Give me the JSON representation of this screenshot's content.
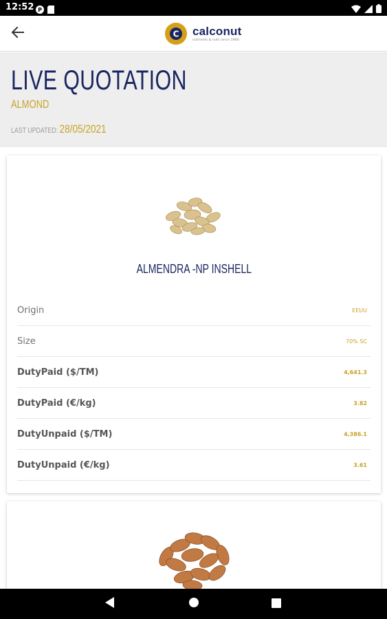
{
  "status_bar": {
    "time": "12:52",
    "left_icons": [
      "notification-p-icon",
      "sim-icon"
    ],
    "right_icons": [
      "wifi-icon",
      "signal-icon",
      "battery-icon"
    ]
  },
  "app_bar": {
    "back_icon": "arrow-back-icon",
    "logo": {
      "name": "calconut",
      "tagline": "nutrients & nuts since 1960",
      "badge_letter": "C"
    }
  },
  "header": {
    "title": "LIVE QUOTATION",
    "subtitle": "ALMOND",
    "last_updated_label": "LAST UPDATED:",
    "last_updated_value": "28/05/2021"
  },
  "products": [
    {
      "name": "ALMENDRA -NP INSHELL",
      "image": "almond-inshell-image",
      "rows": [
        {
          "label": "Origin",
          "value": "EEUU"
        },
        {
          "label": "Size",
          "value": "70% SC"
        },
        {
          "label": "DutyPaid ($/TM)",
          "value": "4,641.3"
        },
        {
          "label": "DutyPaid (€/kg)",
          "value": "3.82"
        },
        {
          "label": "DutyUnpaid ($/TM)",
          "value": "4,386.1"
        },
        {
          "label": "DutyUnpaid (€/kg)",
          "value": "3.61"
        }
      ]
    },
    {
      "image": "almond-kernel-image"
    }
  ],
  "nav_bar": {
    "buttons": [
      "back-triangle-icon",
      "home-circle-icon",
      "recents-square-icon"
    ]
  },
  "colors": {
    "navy": "#1a2560",
    "gold": "#c9a227",
    "header_bg": "#eeeeee"
  }
}
